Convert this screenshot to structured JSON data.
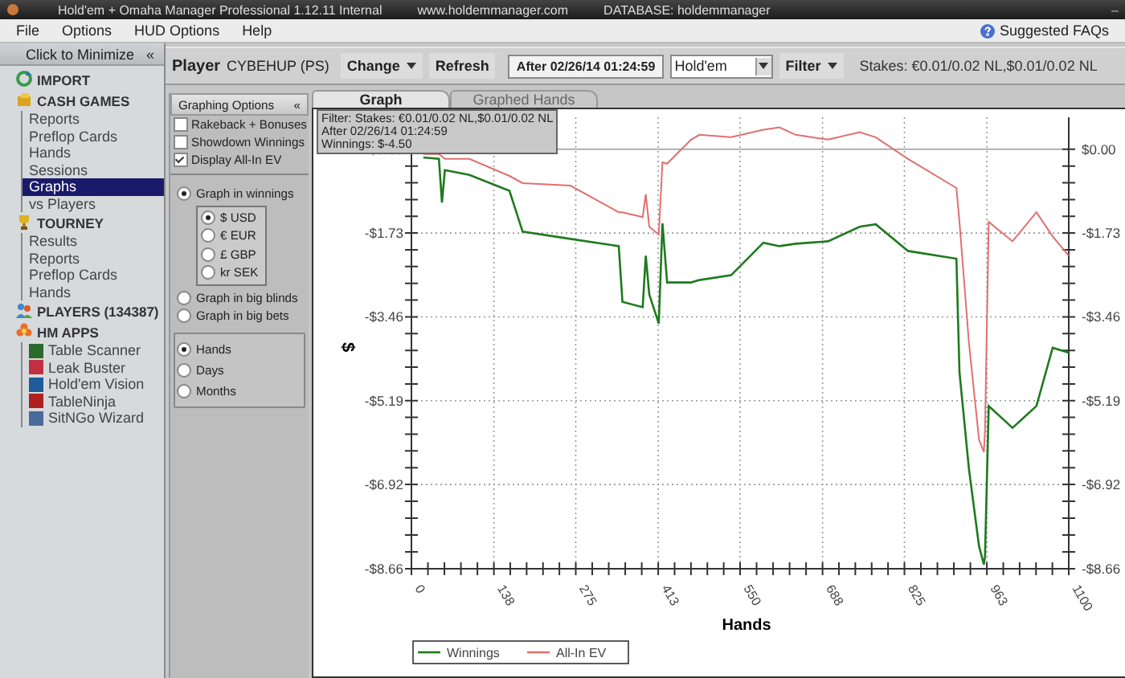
{
  "window": {
    "title": "Hold'em + Omaha Manager Professional 1.12.11 Internal",
    "website": "www.holdemmanager.com",
    "database": "DATABASE: holdemmanager",
    "minimize": "–"
  },
  "menu": [
    "File",
    "Options",
    "HUD Options",
    "Help"
  ],
  "help_link": "Suggested FAQs",
  "sidebar": {
    "header": "Click to Minimize",
    "collapse": "«",
    "items": [
      {
        "label": "IMPORT",
        "selected": false
      },
      {
        "label": "CASH GAMES",
        "selected": false,
        "children": [
          {
            "label": "Reports",
            "selected": false
          },
          {
            "label": "Preflop Cards",
            "selected": false
          },
          {
            "label": "Hands",
            "selected": false
          },
          {
            "label": "Sessions",
            "selected": false
          },
          {
            "label": "Graphs",
            "selected": true
          },
          {
            "label": "vs Players",
            "selected": false
          }
        ]
      },
      {
        "label": "TOURNEY",
        "selected": false,
        "children": [
          {
            "label": "Results",
            "selected": false
          },
          {
            "label": "Reports",
            "selected": false
          },
          {
            "label": "Preflop Cards",
            "selected": false
          },
          {
            "label": "Hands",
            "selected": false
          }
        ]
      },
      {
        "label": "PLAYERS (134387)",
        "selected": false
      },
      {
        "label": "HM APPS",
        "selected": false,
        "children": [
          {
            "label": "Table Scanner",
            "selected": false
          },
          {
            "label": "Leak Buster",
            "selected": false
          },
          {
            "label": "Hold'em Vision",
            "selected": false
          },
          {
            "label": "TableNinja",
            "selected": false
          },
          {
            "label": "SitNGo Wizard",
            "selected": false
          }
        ]
      }
    ]
  },
  "toolbar": {
    "player_label": "Player",
    "player": "CYBEHUP (PS)",
    "change": "Change",
    "refresh": "Refresh",
    "date": "After 02/26/14 01:24:59",
    "game": "Hold'em",
    "filter": "Filter",
    "stakes": "Stakes: €0.01/0.02 NL,$0.01/0.02 NL"
  },
  "graphing_options": {
    "title": "Graphing Options",
    "collapse": "«",
    "options": [
      {
        "label": "Rakeback + Bonuses",
        "checked": false
      },
      {
        "label": "Showdown Winnings",
        "checked": false
      },
      {
        "label": "Display All-In EV",
        "checked": true
      }
    ],
    "units": [
      {
        "label": "Graph in winnings",
        "selected": true,
        "currencies": [
          {
            "label": "$ USD",
            "selected": true
          },
          {
            "label": "€ EUR",
            "selected": false
          },
          {
            "label": "£ GBP",
            "selected": false
          },
          {
            "label": "kr SEK",
            "selected": false
          }
        ]
      },
      {
        "label": "Graph in big blinds",
        "selected": false
      },
      {
        "label": "Graph in big bets",
        "selected": false
      }
    ],
    "x_axis": [
      {
        "label": "Hands",
        "selected": true
      },
      {
        "label": "Days",
        "selected": false
      },
      {
        "label": "Months",
        "selected": false
      }
    ]
  },
  "tabs": [
    {
      "label": "Graph",
      "selected": true
    },
    {
      "label": "Graphed Hands",
      "selected": false
    }
  ],
  "chart": {
    "tooltip": [
      "Filter: Stakes: €0.01/0.02 NL,$0.01/0.02 NL",
      "After 02/26/14 01:24:59",
      "Winnings: $-4.50"
    ],
    "chart_data": {
      "type": "line",
      "grid": true,
      "legend": true,
      "xlabel": "Hands",
      "ylabel": "$",
      "xlim": [
        0,
        1100
      ],
      "ylim": [
        -8.66,
        0.66
      ],
      "xticks": [
        0,
        138,
        275,
        413,
        550,
        688,
        825,
        963,
        1100
      ],
      "yticks": [
        {
          "value": 0,
          "label": "$0.00"
        },
        {
          "value": -1.73,
          "label": "-$1.73"
        },
        {
          "value": -3.46,
          "label": "-$3.46"
        },
        {
          "value": -5.19,
          "label": "-$5.19"
        },
        {
          "value": -6.92,
          "label": "-$6.92"
        },
        {
          "value": -8.66,
          "label": "-$8.66"
        }
      ],
      "x": [
        20,
        46,
        51,
        56,
        97,
        164,
        186,
        266,
        347,
        353,
        387,
        392,
        398,
        414,
        420,
        428,
        468,
        482,
        535,
        589,
        616,
        643,
        697,
        750,
        777,
        831,
        912,
        917,
        933,
        950,
        958,
        960,
        966,
        1006,
        1046,
        1073,
        1100
      ],
      "series": [
        {
          "name": "Winnings",
          "color": "#1e7a1e",
          "values": [
            -0.17,
            -0.2,
            -1.1,
            -0.43,
            -0.53,
            -0.86,
            -1.7,
            -1.85,
            -2.0,
            -3.15,
            -3.26,
            -2.2,
            -3.0,
            -3.6,
            -1.53,
            -2.75,
            -2.75,
            -2.7,
            -2.6,
            -1.93,
            -2.0,
            -1.95,
            -1.9,
            -1.6,
            -1.55,
            -2.1,
            -2.26,
            -4.6,
            -6.6,
            -8.2,
            -8.57,
            -8.4,
            -5.3,
            -5.75,
            -5.3,
            -4.1,
            -4.2
          ]
        },
        {
          "name": "All-In EV",
          "color": "#e07070",
          "values": [
            -0.1,
            -0.1,
            -0.15,
            -0.2,
            -0.2,
            -0.55,
            -0.7,
            -0.75,
            -1.3,
            -1.3,
            -1.4,
            -0.93,
            -1.6,
            -1.76,
            -0.27,
            -0.3,
            0.2,
            0.3,
            0.25,
            0.4,
            0.45,
            0.3,
            0.2,
            0.35,
            0.25,
            -0.2,
            -0.8,
            -1.5,
            -4.0,
            -6.0,
            -6.25,
            -5.8,
            -1.5,
            -1.9,
            -1.3,
            -1.8,
            -2.2
          ]
        }
      ]
    }
  }
}
